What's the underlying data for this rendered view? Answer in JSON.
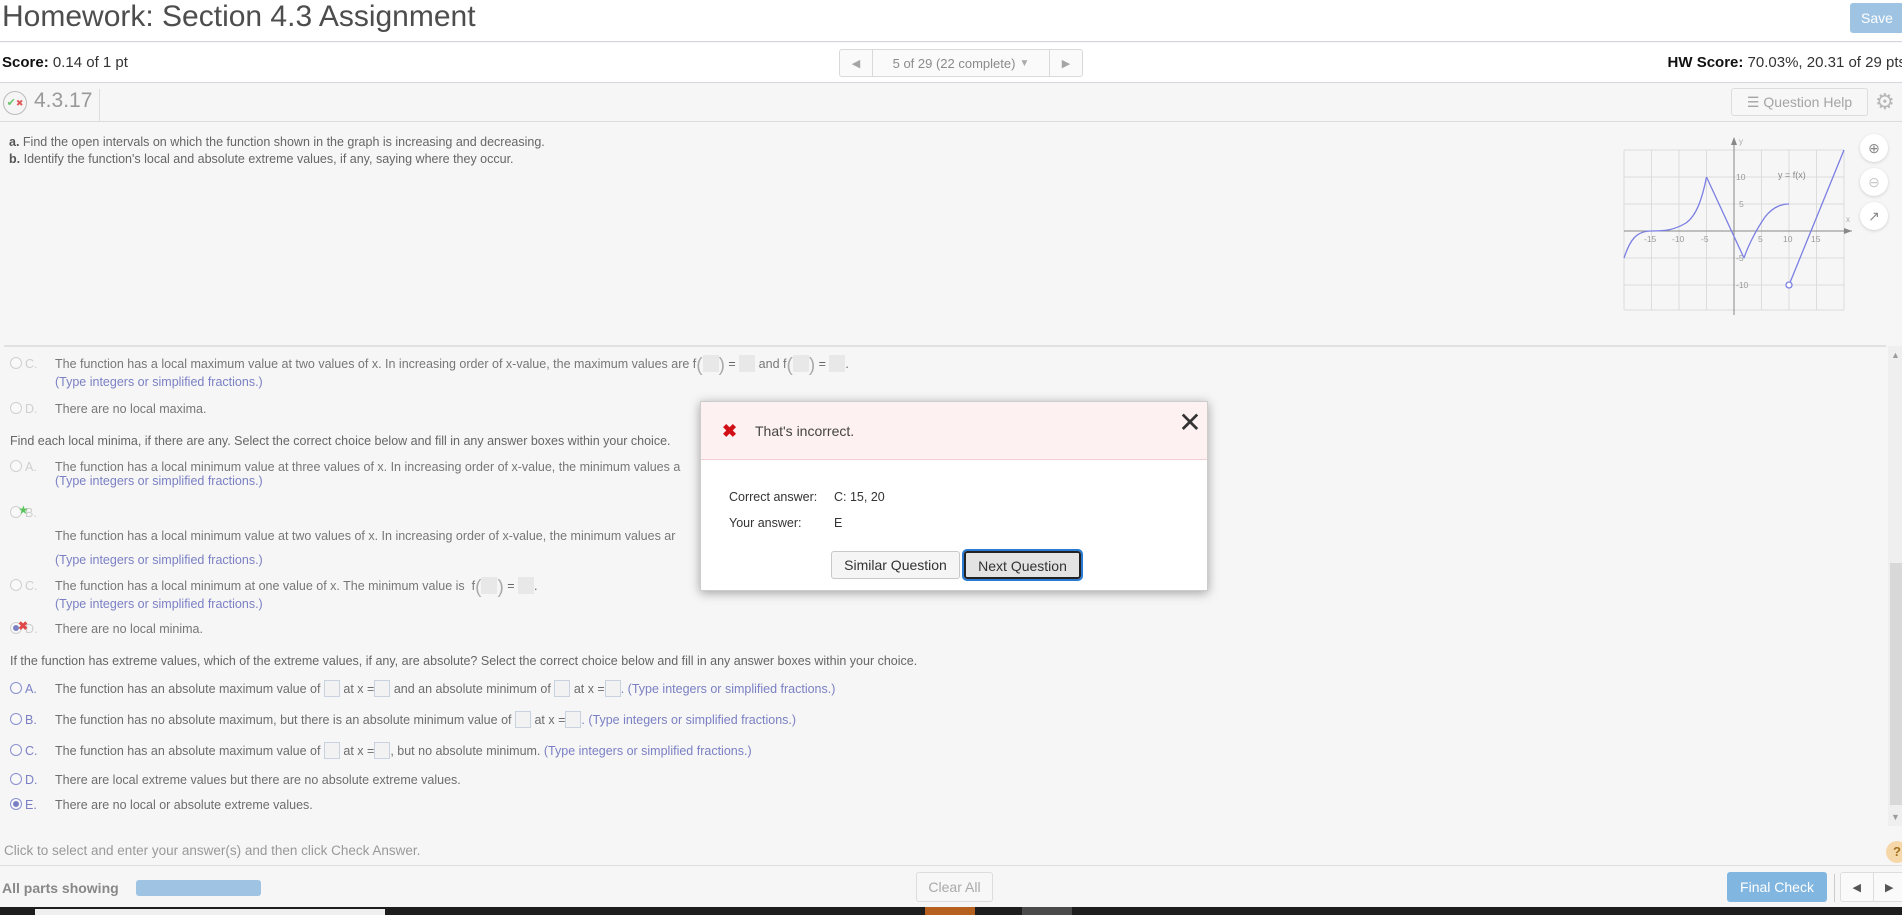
{
  "header": {
    "title": "Homework: Section 4.3 Assignment",
    "save_label": "Save"
  },
  "score_bar": {
    "score_label": "Score:",
    "score_value": "0.14 of 1 pt",
    "question_nav": "5 of 29 (22 complete)",
    "hw_score_label": "HW Score:",
    "hw_score_value": "70.03%, 20.31 of 29 pts"
  },
  "question": {
    "number": "4.3.17",
    "help_label": "Question Help",
    "prompt_a_letter": "a.",
    "prompt_a": "Find the open intervals on which the function shown in the graph is increasing and decreasing.",
    "prompt_b_letter": "b.",
    "prompt_b": "Identify the function's local and absolute extreme values, if any, saying where they occur."
  },
  "graph": {
    "label": "y = f(x)",
    "x_axis_label": "x",
    "y_axis_label": "y",
    "x_ticks": [
      "-15",
      "-10",
      "-5",
      "5",
      "10",
      "15"
    ],
    "y_ticks": [
      "10",
      "5",
      "-5",
      "-10"
    ],
    "curve_color": "#7b7fe3"
  },
  "local_max": {
    "choices": [
      {
        "letter": "C.",
        "text": "The function has a local maximum value at two values of x. In increasing order of x-value, the maximum values are f",
        "and": "and f",
        "hint": "(Type integers or simplified fractions.)"
      },
      {
        "letter": "D.",
        "text": "There are no local maxima."
      }
    ]
  },
  "local_min": {
    "prompt": "Find each local minima, if there are any. Select the correct choice below and fill in any answer boxes within your choice.",
    "choices": [
      {
        "letter": "A.",
        "text": "The function has a local minimum value at three values of x. In increasing order of x-value, the minimum values a",
        "hint": "(Type integers or simplified fractions.)"
      },
      {
        "letter": "B.",
        "text": "The function has a local minimum value at two values of x. In increasing order of x-value, the minimum values ar",
        "hint": "(Type integers or simplified fractions.)",
        "mark": "correct"
      },
      {
        "letter": "C.",
        "text": "The function has a local minimum at one value of x. The minimum value is",
        "fx": "f",
        "hint": "(Type integers or simplified fractions.)"
      },
      {
        "letter": "D.",
        "text": "There are no local minima.",
        "mark": "incorrect"
      }
    ]
  },
  "absolute": {
    "prompt": "If the function has extreme values, which of the extreme values, if any, are absolute? Select the correct choice below and fill in any answer boxes within your choice.",
    "choices": [
      {
        "letter": "A.",
        "t1": "The function has an absolute maximum value of",
        "t2": "at x =",
        "t3": "and an absolute minimum of",
        "t4": "at x =",
        "hint": ". (Type integers or simplified fractions.)"
      },
      {
        "letter": "B.",
        "t1": "The function has no absolute maximum, but there is an absolute minimum value of",
        "t2": "at x =",
        "hint": ". (Type integers or simplified fractions.)"
      },
      {
        "letter": "C.",
        "t1": "The function has an absolute maximum value of",
        "t2": "at x =",
        "t3": ", but no absolute minimum.",
        "hint": "(Type integers or simplified fractions.)"
      },
      {
        "letter": "D.",
        "text": "There are local extreme values but there are no absolute extreme values."
      },
      {
        "letter": "E.",
        "text": "There are no local or absolute extreme values.",
        "selected": true
      }
    ]
  },
  "instruction": "Click to select and enter your answer(s) and then click Check Answer.",
  "footer": {
    "parts_label": "All parts showing",
    "parts_progress": 1.0,
    "clear_all": "Clear All",
    "final_check": "Final Check"
  },
  "modal": {
    "message": "That's incorrect.",
    "correct_label": "Correct answer:",
    "correct_value": "C: 15, 20",
    "your_label": "Your answer:",
    "your_value": "E",
    "similar_btn": "Similar Question",
    "next_btn": "Next Question"
  },
  "colors": {
    "accent": "#7b80c4",
    "primary_button": "#80b6df",
    "error": "#d10f17",
    "correct": "#5cc45c"
  }
}
